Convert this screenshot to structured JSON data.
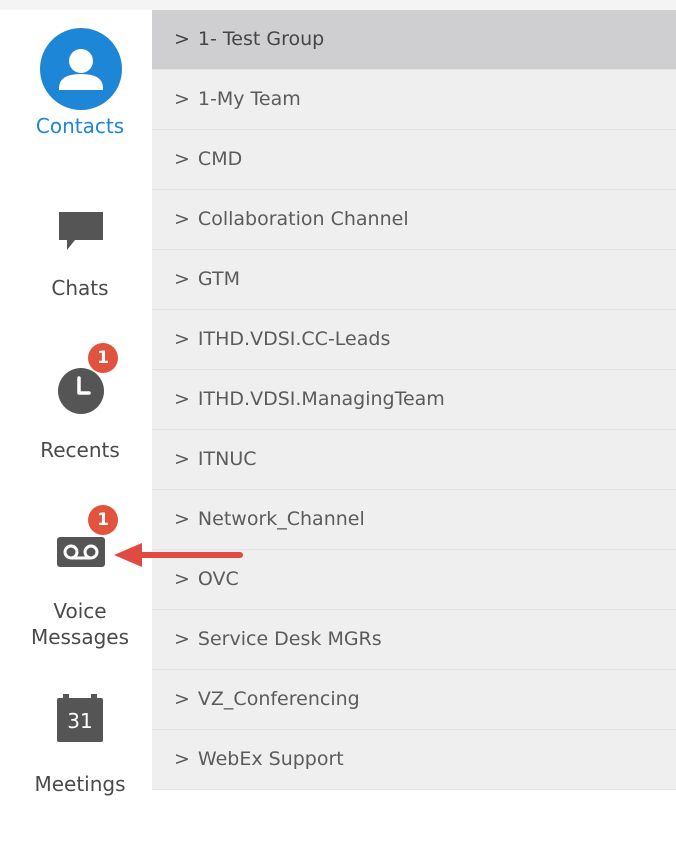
{
  "nav": {
    "contacts": {
      "label": "Contacts",
      "icon": "person-icon"
    },
    "chats": {
      "label": "Chats",
      "icon": "chat-bubble-icon"
    },
    "recents": {
      "label": "Recents",
      "icon": "clock-icon",
      "badge": "1"
    },
    "voice_messages": {
      "label_line1": "Voice",
      "label_line2": "Messages",
      "icon": "voicemail-icon",
      "badge": "1"
    },
    "meetings": {
      "label": "Meetings",
      "icon": "calendar-icon",
      "date": "31"
    }
  },
  "groups": [
    {
      "chevron": ">",
      "name": "1- Test Group",
      "selected": true
    },
    {
      "chevron": ">",
      "name": "1-My Team"
    },
    {
      "chevron": ">",
      "name": "CMD"
    },
    {
      "chevron": ">",
      "name": "Collaboration Channel"
    },
    {
      "chevron": ">",
      "name": "GTM"
    },
    {
      "chevron": ">",
      "name": "ITHD.VDSI.CC-Leads"
    },
    {
      "chevron": ">",
      "name": "ITHD.VDSI.ManagingTeam"
    },
    {
      "chevron": ">",
      "name": "ITNUC"
    },
    {
      "chevron": ">",
      "name": "Network_Channel"
    },
    {
      "chevron": ">",
      "name": "OVC"
    },
    {
      "chevron": ">",
      "name": "Service Desk MGRs"
    },
    {
      "chevron": ">",
      "name": "VZ_Conferencing"
    },
    {
      "chevron": ">",
      "name": "WebEx Support"
    }
  ],
  "colors": {
    "accent": "#1e86d6",
    "badge": "#e2533e",
    "arrow": "#e04a43",
    "icon_gray": "#555555",
    "row_bg": "#efefef",
    "row_selected": "#cfcfd1"
  }
}
